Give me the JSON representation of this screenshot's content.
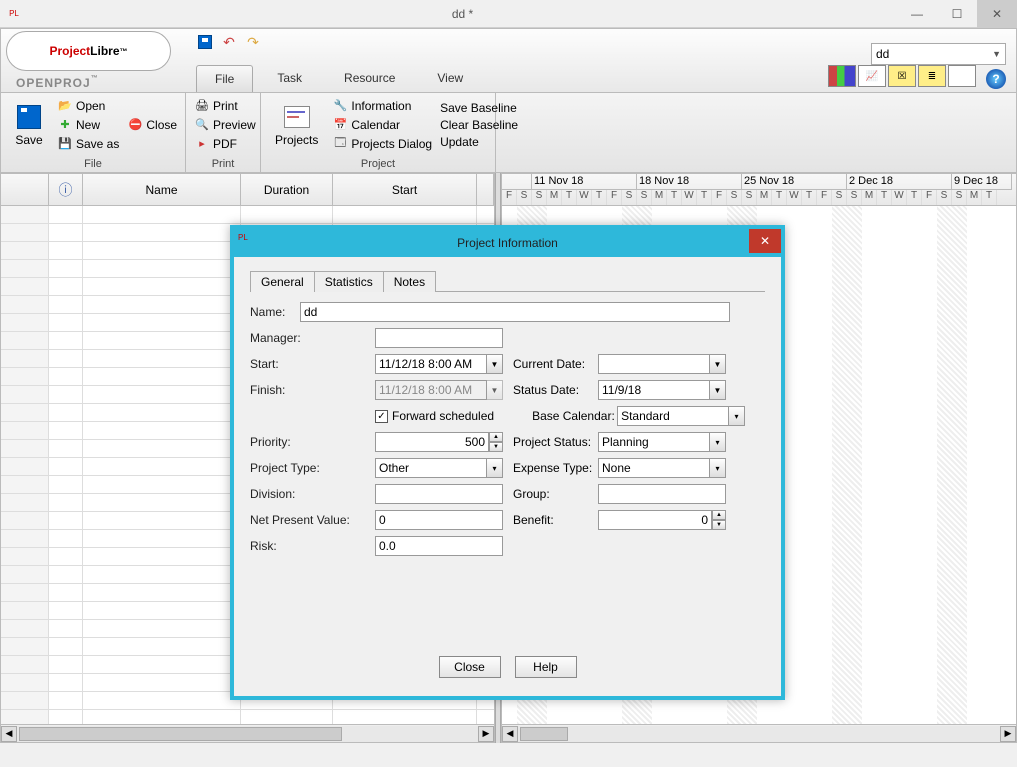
{
  "window": {
    "title": "dd *"
  },
  "top_combo": "dd",
  "ribbon_tabs": {
    "file": "File",
    "task": "Task",
    "resource": "Resource",
    "view": "View"
  },
  "ribbon": {
    "file_group": {
      "label": "File",
      "save": "Save",
      "open": "Open",
      "new": "New",
      "save_as": "Save as",
      "close": "Close"
    },
    "print_group": {
      "label": "Print",
      "print": "Print",
      "preview": "Preview",
      "pdf": "PDF"
    },
    "project_group": {
      "label": "Project",
      "projects": "Projects",
      "information": "Information",
      "calendar": "Calendar",
      "projects_dialog": "Projects Dialog",
      "save_baseline": "Save Baseline",
      "clear_baseline": "Clear Baseline",
      "update": "Update"
    }
  },
  "grid": {
    "col_name": "Name",
    "col_duration": "Duration",
    "col_start": "Start",
    "info_glyph": "ⓘ"
  },
  "timeline": {
    "weeks": [
      "11 Nov 18",
      "18 Nov 18",
      "25 Nov 18",
      "2 Dec 18",
      "9 Dec 18"
    ],
    "day_letters": [
      "F",
      "S",
      "S",
      "M",
      "T",
      "W",
      "T",
      "F",
      "S",
      "S",
      "M",
      "T",
      "W",
      "T",
      "F",
      "S",
      "S",
      "M",
      "T",
      "W",
      "T",
      "F",
      "S",
      "S",
      "M",
      "T",
      "W",
      "T",
      "F",
      "S",
      "S",
      "M",
      "T"
    ]
  },
  "dialog": {
    "title": "Project Information",
    "tabs": {
      "general": "General",
      "statistics": "Statistics",
      "notes": "Notes"
    },
    "labels": {
      "name": "Name:",
      "manager": "Manager:",
      "start": "Start:",
      "finish": "Finish:",
      "forward": "Forward scheduled",
      "priority": "Priority:",
      "project_type": "Project Type:",
      "division": "Division:",
      "npv": "Net Present Value:",
      "risk": "Risk:",
      "current_date": "Current Date:",
      "status_date": "Status Date:",
      "base_calendar": "Base Calendar:",
      "project_status": "Project Status:",
      "expense_type": "Expense Type:",
      "group": "Group:",
      "benefit": "Benefit:"
    },
    "values": {
      "name": "dd",
      "manager": "",
      "start": "11/12/18 8:00 AM",
      "finish": "11/12/18 8:00 AM",
      "forward_checked": "✓",
      "priority": "500",
      "project_type": "Other",
      "division": "",
      "npv": "0",
      "risk": "0.0",
      "current_date": "",
      "status_date": "11/9/18",
      "base_calendar": "Standard",
      "project_status": "Planning",
      "expense_type": "None",
      "group": "",
      "benefit": "0"
    },
    "buttons": {
      "close": "Close",
      "help": "Help"
    }
  },
  "logo": {
    "project": "Project",
    "libre": "Libre",
    "openproj": "OPENPROJ"
  }
}
